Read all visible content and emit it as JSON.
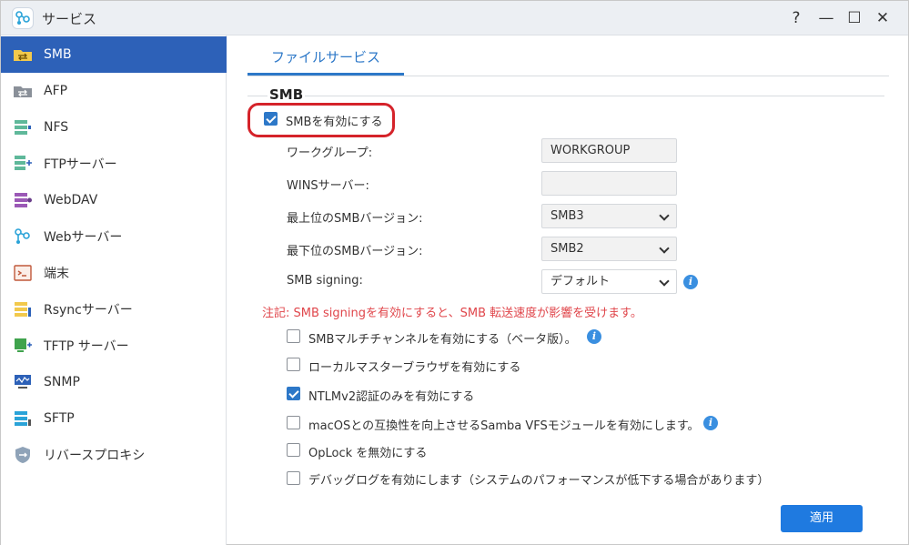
{
  "window": {
    "title": "サービス",
    "controls": {
      "help": "?",
      "minimize": "—",
      "maximize": "☐",
      "close": "✕"
    }
  },
  "sidebar": {
    "items": [
      {
        "label": "SMB",
        "icon": "smb-folder-icon",
        "active": true
      },
      {
        "label": "AFP",
        "icon": "afp-folder-icon"
      },
      {
        "label": "NFS",
        "icon": "nfs-icon"
      },
      {
        "label": "FTPサーバー",
        "icon": "ftp-server-icon"
      },
      {
        "label": "WebDAV",
        "icon": "webdav-icon"
      },
      {
        "label": "Webサーバー",
        "icon": "web-server-icon"
      },
      {
        "label": "端末",
        "icon": "terminal-icon"
      },
      {
        "label": "Rsyncサーバー",
        "icon": "rsync-server-icon"
      },
      {
        "label": "TFTP サーバー",
        "icon": "tftp-server-icon"
      },
      {
        "label": "SNMP",
        "icon": "snmp-icon"
      },
      {
        "label": "SFTP",
        "icon": "sftp-icon"
      },
      {
        "label": "リバースプロキシ",
        "icon": "reverse-proxy-icon"
      }
    ]
  },
  "main": {
    "tab": "ファイルサービス",
    "section_title": "SMB",
    "enable_smb": {
      "label": "SMBを有効にする",
      "checked": true
    },
    "fields": {
      "workgroup": {
        "label": "ワークグループ:",
        "value": "WORKGROUP"
      },
      "wins": {
        "label": "WINSサーバー:",
        "value": ""
      },
      "max_version": {
        "label": "最上位のSMBバージョン:",
        "value": "SMB3"
      },
      "min_version": {
        "label": "最下位のSMBバージョン:",
        "value": "SMB2"
      },
      "signing": {
        "label": "SMB signing:",
        "value": "デフォルト"
      }
    },
    "note": "注記: SMB signingを有効にすると、SMB 転送速度が影響を受けます。",
    "options": [
      {
        "label": "SMBマルチチャンネルを有効にする（ベータ版）。",
        "checked": false,
        "info": true
      },
      {
        "label": "ローカルマスターブラウザを有効にする",
        "checked": false
      },
      {
        "label": "NTLMv2認証のみを有効にする",
        "checked": true
      },
      {
        "label": "macOSとの互換性を向上させるSamba VFSモジュールを有効にします。",
        "checked": false,
        "info": true
      },
      {
        "label": "OpLock を無効にする",
        "checked": false
      },
      {
        "label": "デバッグログを有効にします（システムのパフォーマンスが低下する場合があります）",
        "checked": false
      }
    ],
    "apply_label": "適用"
  },
  "colors": {
    "accent": "#2d61b8",
    "link": "#2d78c8",
    "button": "#1f7ae0",
    "warning": "#e0464b",
    "highlight": "#d5232a"
  }
}
